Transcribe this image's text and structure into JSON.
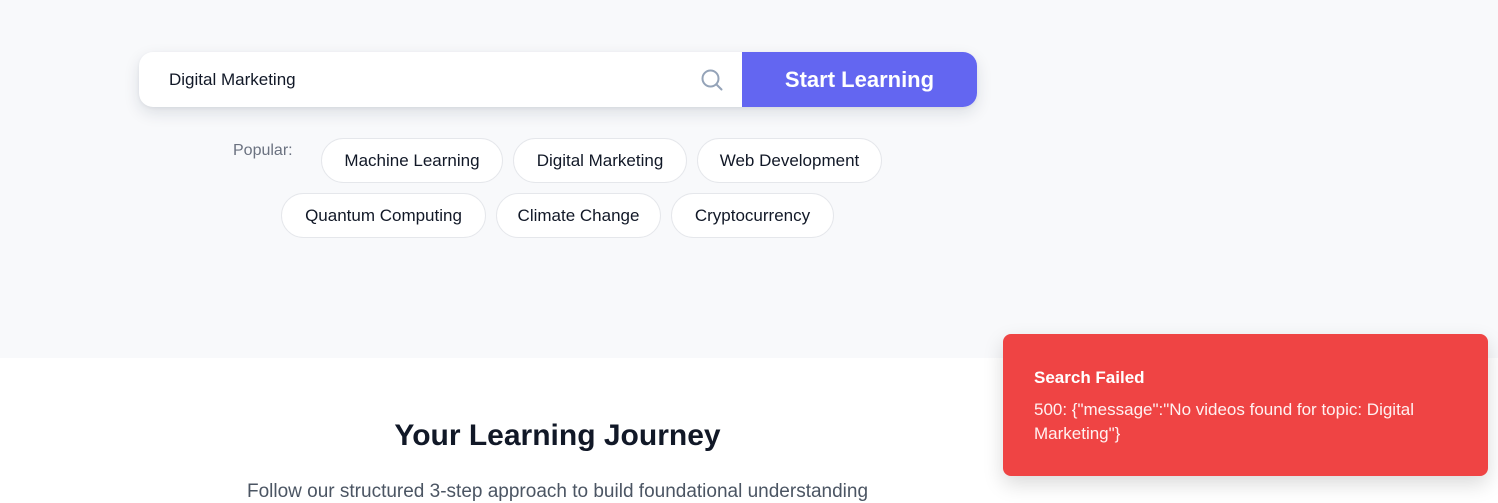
{
  "search": {
    "value": "Digital Marketing",
    "button_label": "Start Learning"
  },
  "popular": {
    "label": "Popular:",
    "topics": [
      "Machine Learning",
      "Digital Marketing",
      "Web Development",
      "Quantum Computing",
      "Climate Change",
      "Cryptocurrency"
    ]
  },
  "journey": {
    "title": "Your Learning Journey",
    "description": "Follow our structured 3-step approach to build foundational understanding"
  },
  "toast": {
    "title": "Search Failed",
    "message": "500: {\"message\":\"No videos found for topic: Digital Marketing\"}"
  },
  "colors": {
    "accent": "#6366f1",
    "error": "#ef4444",
    "hero_background": "#f8f9fb"
  },
  "icons": {
    "search": "search-icon"
  }
}
